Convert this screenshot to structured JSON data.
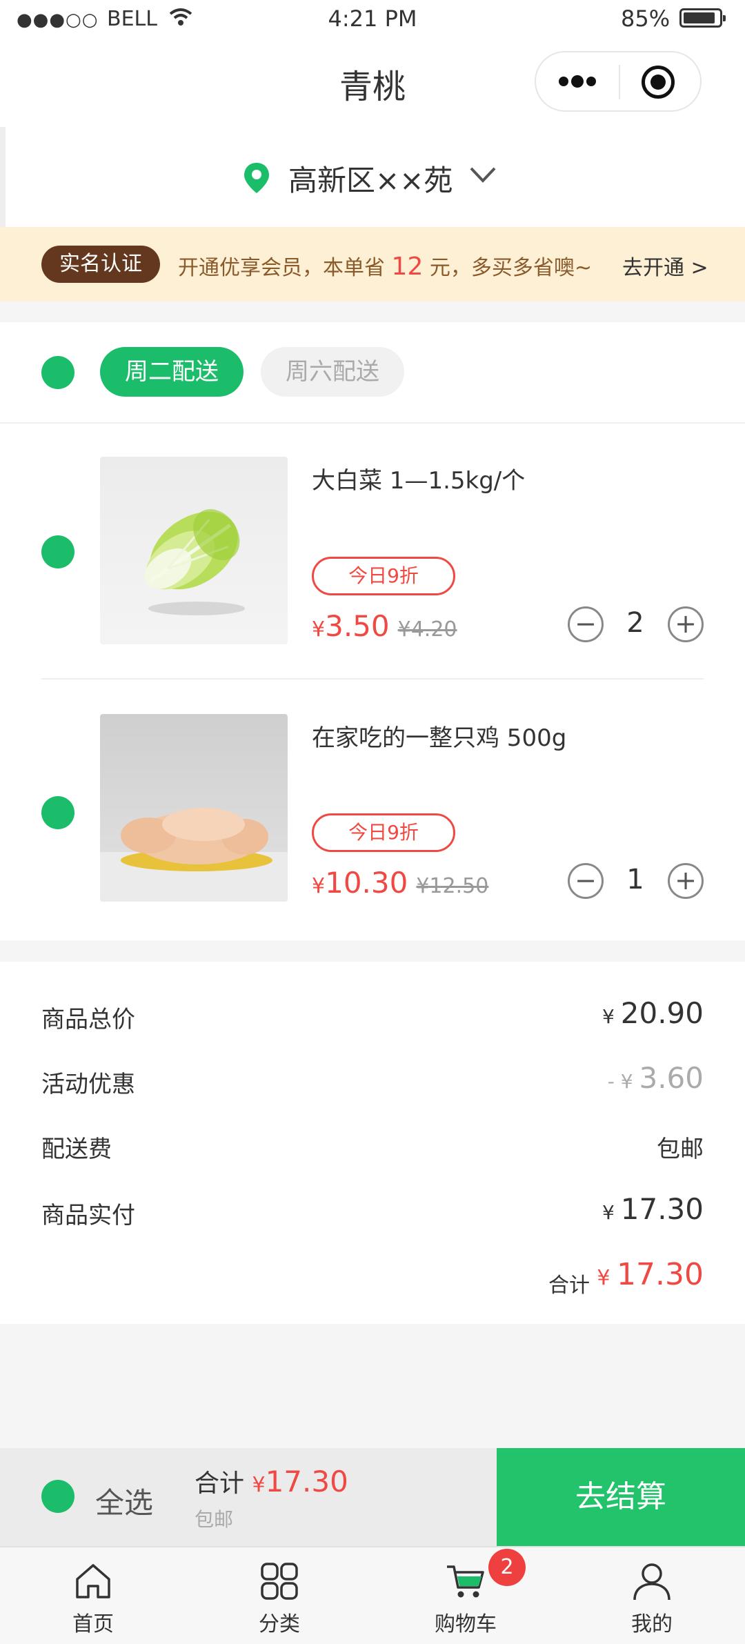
{
  "status_bar": {
    "carrier": "BELL",
    "time": "4:21 PM",
    "battery": "85%"
  },
  "nav": {
    "title": "青桃"
  },
  "address": {
    "text": "高新区××苑"
  },
  "banner": {
    "tag": "实名认证",
    "msg_prefix": "开通优享会员，本单省",
    "saving": "12",
    "msg_suffix": "元，多买多省噢~",
    "cta": "去开通 >"
  },
  "delivery_tabs": [
    {
      "label": "周二配送",
      "active": true
    },
    {
      "label": "周六配送",
      "active": false
    }
  ],
  "items": [
    {
      "name": "大白菜  1—1.5kg/个",
      "promo": "今日9折",
      "price": "3.50",
      "old_price": "¥4.20",
      "qty": "2",
      "currency": "¥"
    },
    {
      "name": "在家吃的一整只鸡 500g",
      "promo": "今日9折",
      "price": "10.30",
      "old_price": "¥12.50",
      "qty": "1",
      "currency": "¥"
    }
  ],
  "summary": {
    "rows": [
      {
        "label": "商品总价",
        "value": "20.90",
        "prefix": "¥ "
      },
      {
        "label": "活动优惠",
        "value": "3.60",
        "prefix": "- ¥ "
      },
      {
        "label": "配送费",
        "value": "包邮"
      },
      {
        "label": "商品实付",
        "value": "17.30",
        "prefix": "¥ "
      }
    ],
    "total_label": "合计",
    "total_currency": "¥ ",
    "total_value": "17.30"
  },
  "checkout": {
    "select_all": "全选",
    "sum_label": "合计",
    "currency": "¥",
    "amount": "17.30",
    "shipping": "包邮",
    "button": "去结算"
  },
  "tabbar": [
    {
      "label": "首页",
      "icon": "home-icon"
    },
    {
      "label": "分类",
      "icon": "category-icon"
    },
    {
      "label": "购物车",
      "icon": "cart-icon",
      "badge": "2"
    },
    {
      "label": "我的",
      "icon": "user-icon"
    }
  ],
  "colors": {
    "accent": "#1bbd6a",
    "price": "#f04842",
    "banner_bg": "#fdf0d5",
    "tag_bg": "#63381e"
  }
}
